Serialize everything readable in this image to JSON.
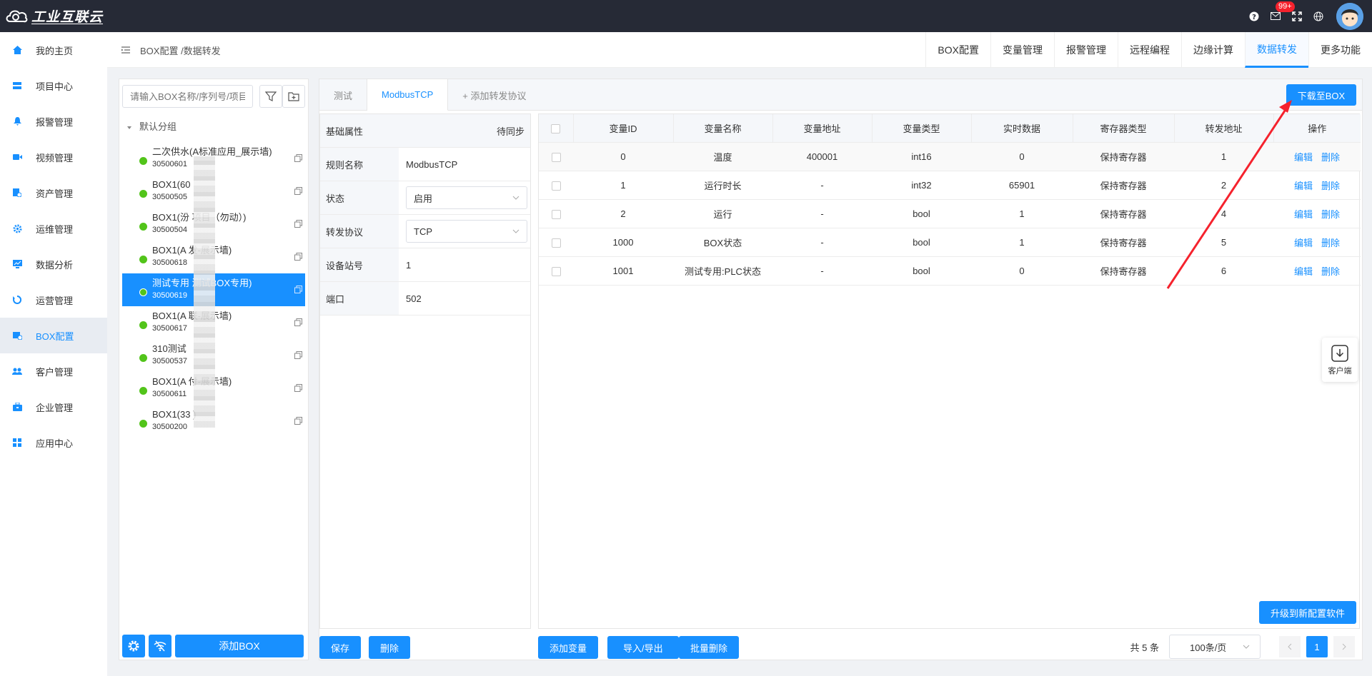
{
  "app": {
    "logo_text": "工业互联云",
    "notif_count": "99+"
  },
  "sidebar": {
    "items": [
      {
        "label": "我的主页",
        "icon": "home-icon"
      },
      {
        "label": "项目中心",
        "icon": "project-icon"
      },
      {
        "label": "报警管理",
        "icon": "bell-icon"
      },
      {
        "label": "视频管理",
        "icon": "video-icon"
      },
      {
        "label": "资产管理",
        "icon": "asset-icon"
      },
      {
        "label": "运维管理",
        "icon": "gear-icon"
      },
      {
        "label": "数据分析",
        "icon": "chart-icon"
      },
      {
        "label": "运营管理",
        "icon": "cycle-icon"
      },
      {
        "label": "BOX配置",
        "icon": "box-icon"
      },
      {
        "label": "客户管理",
        "icon": "users-icon"
      },
      {
        "label": "企业管理",
        "icon": "briefcase-icon"
      },
      {
        "label": "应用中心",
        "icon": "apps-icon"
      }
    ]
  },
  "header": {
    "breadcrumb": "BOX配置 /数据转发",
    "tabs": [
      "BOX配置",
      "变量管理",
      "报警管理",
      "远程编程",
      "边缘计算",
      "数据转发",
      "更多功能"
    ]
  },
  "left": {
    "search_placeholder": "请输入BOX名称/序列号/项目",
    "group": "默认分组",
    "devices": [
      {
        "name": "二次供水(A标准应用_展示墙)",
        "sn": "30500601"
      },
      {
        "name": "BOX1(60",
        "sn": "30500505"
      },
      {
        "name": "BOX1(汾    项目（勿动）)",
        "sn": "30500504"
      },
      {
        "name": "BOX1(A      发-展示墙)",
        "sn": "30500618"
      },
      {
        "name": "测试专用       测试BOX专用)",
        "sn": "30500619"
      },
      {
        "name": "BOX1(A      联-展示墙)",
        "sn": "30500617"
      },
      {
        "name": "310测试",
        "sn": "30500537"
      },
      {
        "name": "BOX1(A      付-展示墙)",
        "sn": "30500611"
      },
      {
        "name": "BOX1(33      )",
        "sn": "30500200"
      }
    ],
    "add_box": "添加BOX"
  },
  "protocol": {
    "tabs": [
      "测试",
      "ModbusTCP",
      "+ 添加转发协议"
    ],
    "download": "下载至BOX"
  },
  "props": {
    "header": "基础属性",
    "sync": "待同步",
    "rows": [
      {
        "label": "规则名称",
        "value": "ModbusTCP"
      },
      {
        "label": "状态",
        "value": "启用"
      },
      {
        "label": "转发协议",
        "value": "TCP"
      },
      {
        "label": "设备站号",
        "value": "1"
      },
      {
        "label": "端口",
        "value": "502"
      }
    ],
    "save": "保存",
    "delete": "删除"
  },
  "table": {
    "columns": [
      "变量ID",
      "变量名称",
      "变量地址",
      "变量类型",
      "实时数据",
      "寄存器类型",
      "转发地址",
      "操作"
    ],
    "rows": [
      [
        "0",
        "温度",
        "400001",
        "int16",
        "0",
        "保持寄存器",
        "1"
      ],
      [
        "1",
        "运行时长",
        "-",
        "int32",
        "65901",
        "保持寄存器",
        "2"
      ],
      [
        "2",
        "运行",
        "-",
        "bool",
        "1",
        "保持寄存器",
        "4"
      ],
      [
        "1000",
        "BOX状态",
        "-",
        "bool",
        "1",
        "保持寄存器",
        "5"
      ],
      [
        "1001",
        "测试专用:PLC状态",
        "-",
        "bool",
        "0",
        "保持寄存器",
        "6"
      ]
    ],
    "edit": "编辑",
    "remove": "删除",
    "upgrade": "升级到新配置软件",
    "add_var": "添加变量",
    "import_export": "导入/导出",
    "batch_delete": "批量删除",
    "total": "共 5 条",
    "page_size": "100条/页",
    "page": "1"
  },
  "float": {
    "label": "客户端"
  }
}
